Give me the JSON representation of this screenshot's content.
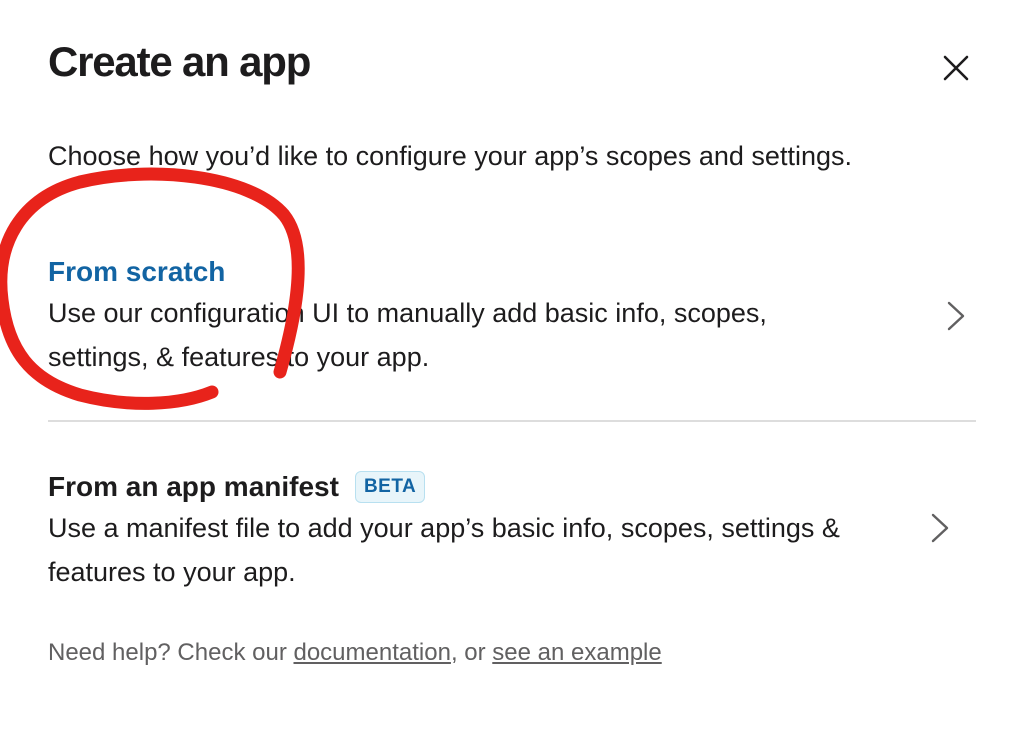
{
  "dialog": {
    "title": "Create an app",
    "subtitle": "Choose how you’d like to configure your app’s scopes and settings."
  },
  "options": [
    {
      "title": "From scratch",
      "description": "Use our configuration UI to manually add basic info, scopes, settings, & features to your app."
    },
    {
      "title": "From an app manifest",
      "badge": "BETA",
      "description": "Use a manifest file to add your app’s basic info, scopes, settings & features to your app."
    }
  ],
  "help": {
    "prefix": "Need help? Check our ",
    "documentation_link": "documentation",
    "separator": ", or ",
    "example_link": "see an example"
  },
  "icons": {
    "close": "close-icon",
    "chevron": "chevron-right-icon"
  },
  "colors": {
    "link_blue": "#1264a3",
    "annotation_red": "#e8231b",
    "badge_bg": "#e8f5fa"
  }
}
